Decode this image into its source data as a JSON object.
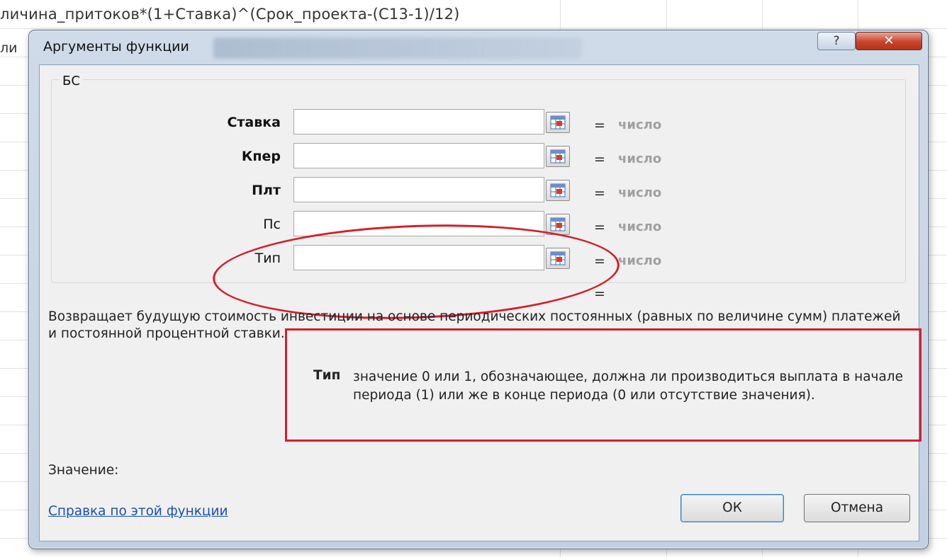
{
  "spreadsheet": {
    "formula_line": "личина_притоков*(1+Ставка)^(Срок_проекта-(C13-1)/12)",
    "fragment": "ли"
  },
  "dialog": {
    "title": "Аргументы функции",
    "help_glyph": "?",
    "close_glyph": "✕",
    "function_name": "БС",
    "arguments": [
      {
        "label": "Ставка",
        "required": true,
        "value": "",
        "result": "число"
      },
      {
        "label": "Кпер",
        "required": true,
        "value": "",
        "result": "число"
      },
      {
        "label": "Плт",
        "required": true,
        "value": "",
        "result": "число"
      },
      {
        "label": "Пс",
        "required": false,
        "value": "",
        "result": "число"
      },
      {
        "label": "Тип",
        "required": false,
        "value": "",
        "result": "число"
      }
    ],
    "equals": "=",
    "result_equals": "=",
    "description": "Возвращает будущую стоимость инвестиции на основе периодических постоянных (равных по величине сумм) платежей и постоянной процентной ставки.",
    "argument_help": {
      "name": "Тип",
      "text": "значение 0 или 1, обозначающее, должна ли производиться выплата в начале периода (1) или же в конце периода (0 или отсутствие значения)."
    },
    "value_label": "Значение:",
    "help_link": "Справка по этой функции",
    "ok_label": "ОК",
    "cancel_label": "Отмена"
  },
  "icons": {
    "ref_button": "range-select-icon"
  },
  "colors": {
    "annotation_red": "#d41e2c",
    "link_blue": "#1a4fb5",
    "placeholder_gray": "#a0a0a0"
  }
}
